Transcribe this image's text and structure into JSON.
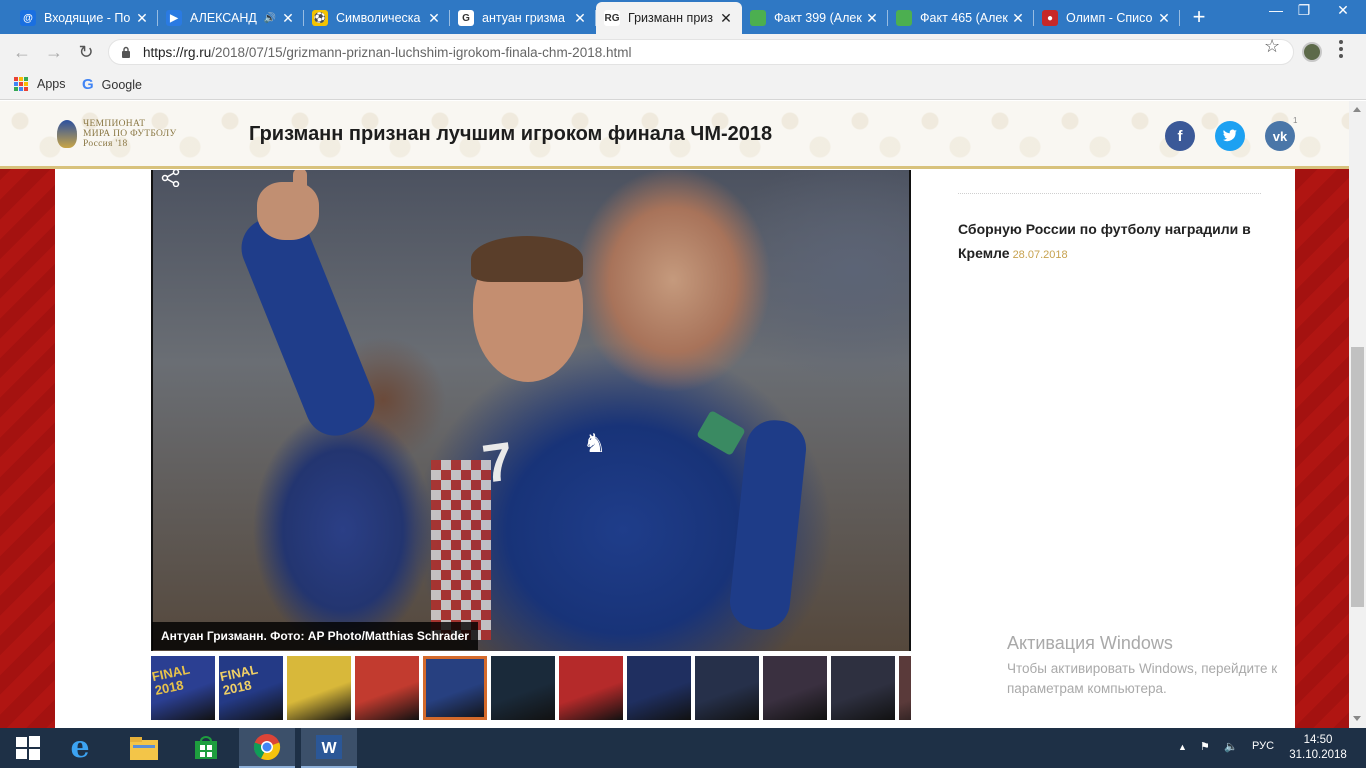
{
  "browser": {
    "tabs": [
      {
        "title": "Входящие - По",
        "favicon": "mail-ru-icon",
        "color": "#1a6fe0",
        "glyph": "@",
        "active": false
      },
      {
        "title": "АЛЕКСАНД",
        "favicon": "play-icon",
        "color": "#2a7ae2",
        "glyph": "▶",
        "active": false,
        "audio": true
      },
      {
        "title": "Символическа",
        "favicon": "ball-icon",
        "color": "#f3c300",
        "glyph": "⚽",
        "active": false
      },
      {
        "title": "антуан гризма",
        "favicon": "google-icon",
        "color": "#ffffff",
        "glyph": "G",
        "active": false
      },
      {
        "title": "Гризманн приз",
        "favicon": "rg-icon",
        "color": "#ffffff",
        "glyph": "RG",
        "active": true
      },
      {
        "title": "Факт 399 (Алек",
        "favicon": "green-square-icon",
        "color": "#4caf50",
        "glyph": "",
        "active": false
      },
      {
        "title": "Факт 465 (Алек",
        "favicon": "green-square-icon",
        "color": "#4caf50",
        "glyph": "",
        "active": false
      },
      {
        "title": "Олимп - Списо",
        "favicon": "olimp-icon",
        "color": "#c62828",
        "glyph": "●",
        "active": false
      }
    ],
    "close_glyph": "✕",
    "new_tab_glyph": "+",
    "window_buttons": {
      "minimize": "—",
      "maximize": "❐",
      "close": "✕"
    },
    "nav": {
      "back": "←",
      "forward": "→",
      "reload": "↻"
    },
    "url": {
      "host": "https://rg.ru",
      "path": "/2018/07/15/grizmann-priznan-luchshim-igrokom-finala-chm-2018.html"
    },
    "star_glyph": "☆",
    "bookmarks": [
      {
        "label": "Apps",
        "icon": "apps-grid-icon"
      },
      {
        "label": "Google",
        "icon": "google-icon"
      }
    ]
  },
  "site": {
    "logo": {
      "line1": "Чемпионат",
      "line2": "мира по футболу",
      "line3": "Россия '18"
    },
    "headline": "Гризманн признан лучшим игроком финала ЧМ-2018",
    "social": [
      {
        "name": "facebook",
        "glyph": "f",
        "color": "#3b5998"
      },
      {
        "name": "twitter",
        "glyph": "t",
        "color": "#1da1f2"
      },
      {
        "name": "vk",
        "glyph": "vk",
        "color": "#4a76a8"
      }
    ],
    "vk_count": "1"
  },
  "photo": {
    "caption": "Антуан Гризманн. Фото: AP Photo/Matthias Schrader",
    "shirt_number": "7",
    "thumbnails": [
      {
        "label": "FINAL 2018",
        "bg": "#2b3f92",
        "fg": "#e8c34a"
      },
      {
        "label": "FINAL 2018",
        "bg": "#243a86",
        "fg": "#f0d066"
      },
      {
        "label": "",
        "bg": "#d8b83a",
        "fg": "#ffffff"
      },
      {
        "label": "",
        "bg": "#c23b2f",
        "fg": "#ffffff"
      },
      {
        "label": "",
        "bg": "#274080",
        "fg": "#ffffff"
      },
      {
        "label": "",
        "bg": "#1a2a3a",
        "fg": "#e0c040"
      },
      {
        "label": "",
        "bg": "#b52a2a",
        "fg": "#ffffff"
      },
      {
        "label": "",
        "bg": "#1f2f60",
        "fg": "#ffffff"
      },
      {
        "label": "",
        "bg": "#26304a",
        "fg": "#ffffff"
      },
      {
        "label": "",
        "bg": "#3a3040",
        "fg": "#ffffff"
      },
      {
        "label": "",
        "bg": "#2e3040",
        "fg": "#ffffff"
      },
      {
        "label": "",
        "bg": "#5a3a3a",
        "fg": "#ffffff"
      }
    ],
    "selected_thumbnail": 4
  },
  "sidebar": {
    "link_text": "Сборную России по футболу наградили в Кремле",
    "link_date": "28.07.2018"
  },
  "windows_activation": {
    "title": "Активация Windows",
    "line1": "Чтобы активировать Windows, перейдите к",
    "line2": "параметрам компьютера."
  },
  "taskbar": {
    "apps": [
      {
        "name": "start",
        "icon": "windows-logo-icon"
      },
      {
        "name": "internet-explorer",
        "icon": "ie-icon"
      },
      {
        "name": "file-explorer",
        "icon": "folder-icon"
      },
      {
        "name": "store",
        "icon": "store-icon"
      },
      {
        "name": "chrome",
        "icon": "chrome-icon"
      },
      {
        "name": "word",
        "icon": "word-icon"
      }
    ],
    "language": "РУС",
    "time": "14:50",
    "date": "31.10.2018"
  }
}
